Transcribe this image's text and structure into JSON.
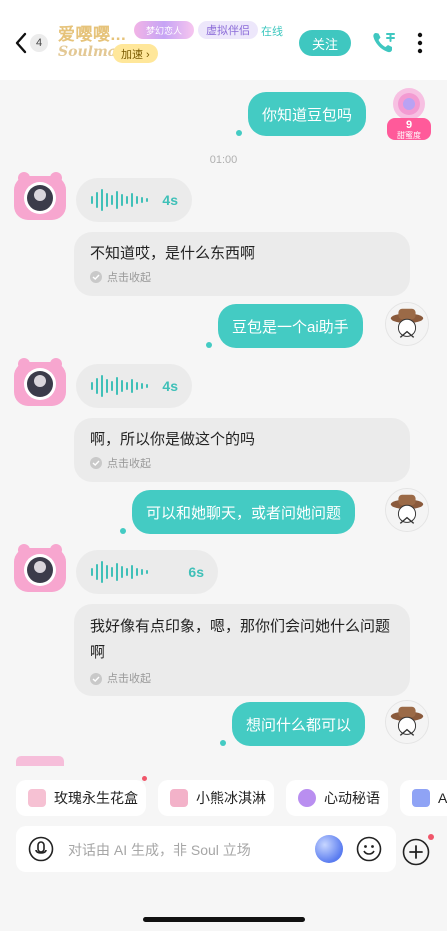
{
  "header": {
    "back_count": "4",
    "name": "爱嘤嘤...",
    "name_badge": "梦幻恋人",
    "tag": "虚拟伴侣",
    "status": "在线",
    "subtitle": "Soulmate",
    "speed_label": "加速 ›",
    "follow_label": "关注"
  },
  "lolly_badge": {
    "number": "9",
    "label": "甜蜜度"
  },
  "timestamp": "01:00",
  "messages": {
    "m1_text": "你知道豆包吗",
    "v1_duration": "4s",
    "m2_text": "不知道哎，是什么东西啊",
    "m2_collapse": "点击收起",
    "m3_text": "豆包是一个ai助手",
    "v2_duration": "4s",
    "m4_text": "啊，所以你是做这个的吗",
    "m4_collapse": "点击收起",
    "m5_text": "可以和她聊天，或者问她问题",
    "v3_duration": "6s",
    "m6_text": "我好像有点印象，嗯，那你们会问她什么问题啊",
    "m6_collapse": "点击收起",
    "m7_text": "想问什么都可以"
  },
  "chips": [
    {
      "label": "玫瑰永生花盒",
      "icon": "rose-box-icon",
      "color": "#f6c1d3"
    },
    {
      "label": "小熊冰淇淋",
      "icon": "ice-cream-icon",
      "color": "#f3b2c9"
    },
    {
      "label": "心动秘语",
      "icon": "heart-icon",
      "color": "#b98ef0"
    },
    {
      "label": "AI",
      "icon": "ai-grid-icon",
      "color": "#8fa3f5"
    }
  ],
  "input": {
    "placeholder": "对话由 AI 生成，非 Soul 立场"
  },
  "colors": {
    "accent": "#44cbc3",
    "name_gold": "#e6c37a",
    "bubble_gray": "#ebebeb",
    "tag_purple": "#8b6bd8"
  }
}
